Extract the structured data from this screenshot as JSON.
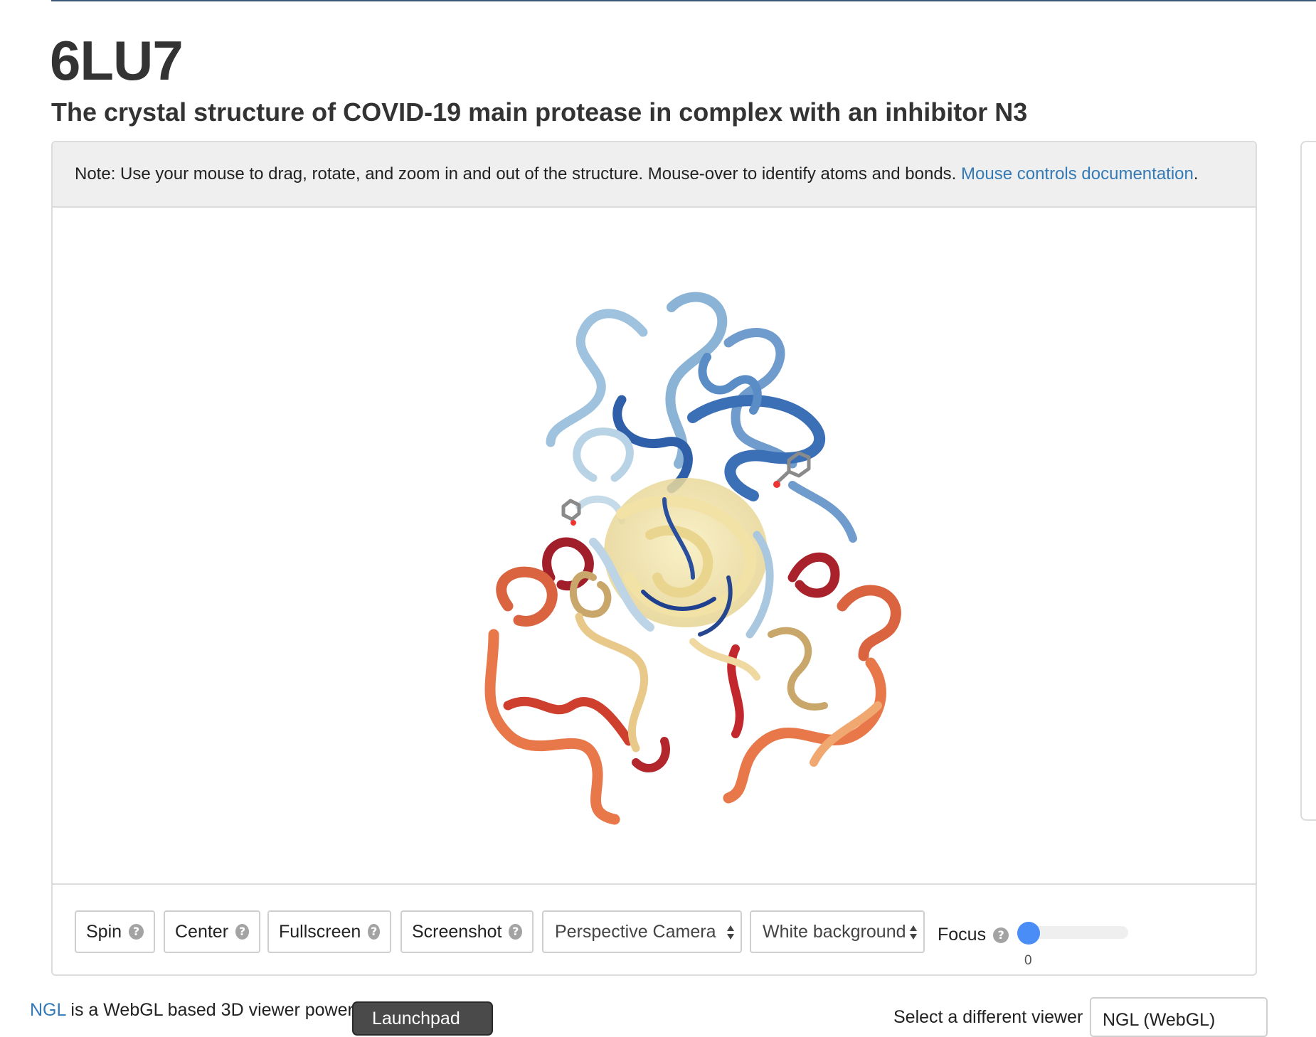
{
  "header": {
    "pdb_id": "6LU7",
    "title": "The crystal structure of COVID-19 main protease in complex with an inhibitor N3"
  },
  "note": {
    "text": "Note: Use your mouse to drag, rotate, and zoom in and out of the structure. Mouse-over to identify atoms and bonds. ",
    "link_label": "Mouse controls documentation",
    "suffix": "."
  },
  "controls": {
    "spin_label": "Spin",
    "center_label": "Center",
    "fullscreen_label": "Fullscreen",
    "screenshot_label": "Screenshot",
    "camera_value": "Perspective Camera",
    "background_value": "White background",
    "focus_label": "Focus",
    "focus_value": "0",
    "focus_level": 0,
    "help_glyph": "?"
  },
  "footer": {
    "ngl_link": "NGL",
    "text": " is a WebGL based 3D viewer powered",
    "launchpad_label": "Launchpad",
    "select_label": "Select a different viewer",
    "viewer_value": "NGL (WebGL)"
  },
  "colors": {
    "link": "#337ab7",
    "slider_thumb": "#4a8df6",
    "ribbon_blue": "#3b6fb6",
    "ribbon_lightblue": "#9fc2de",
    "ribbon_yellow": "#f2e2a6",
    "ribbon_orange": "#e8774a",
    "ribbon_red": "#b3262b"
  },
  "icons": [
    "help-icon",
    "select-arrows-icon"
  ]
}
